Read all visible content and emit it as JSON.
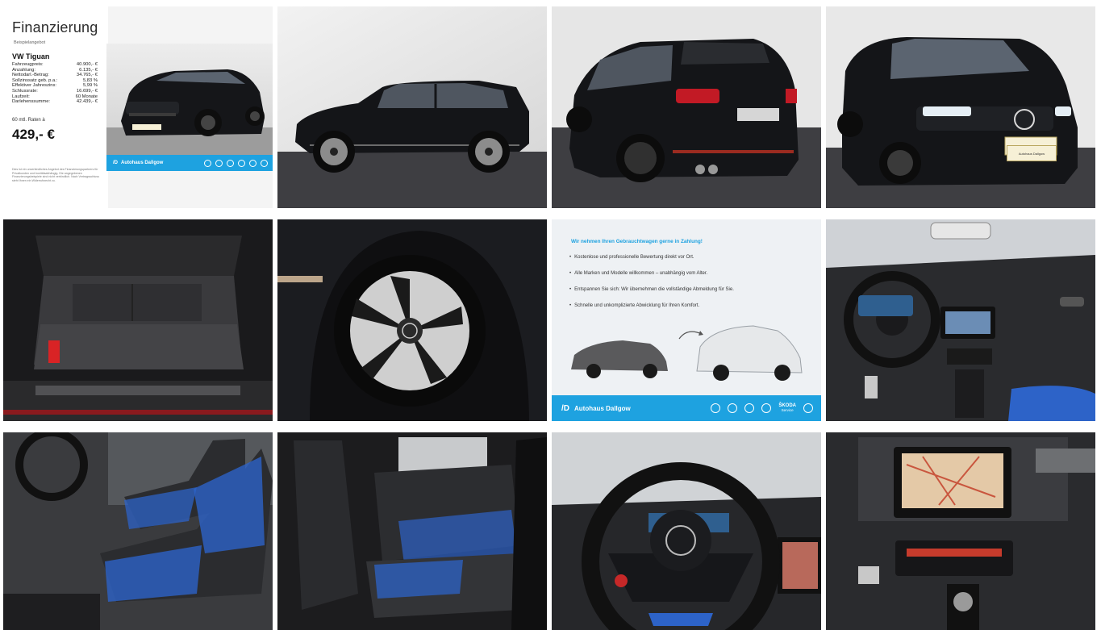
{
  "gallery": {
    "financing_card": {
      "title": "Finanzierung",
      "subtitle": "Beispielangebot",
      "model": "VW Tiguan",
      "rows": [
        {
          "label": "Fahrzeugpreis:",
          "value": "40.900,- €"
        },
        {
          "label": "Anzahlung:",
          "value": "6.135,- €"
        },
        {
          "label": "Nettodarl.-Betrag:",
          "value": "34.765,- €"
        },
        {
          "label": "Sollzinssatz geb. p.a.:",
          "value": "5,83 %"
        },
        {
          "label": "Effektiver Jahreszins:",
          "value": "5,99 %"
        },
        {
          "label": "Schlussrate:",
          "value": "16.699,- €"
        },
        {
          "label": "Laufzeit:",
          "value": "60 Monate"
        },
        {
          "label": "Darlehenssumme:",
          "value": "42.439,- €"
        }
      ],
      "rates_label": "60 mtl. Raten à",
      "monthly_rate": "429,- €",
      "fine_print": "Dies ist ein unverbindliches Angebot des Finanzierungspartners für Privatkunden und bonitätsabhängig. Die angegebenen Finanzierungsbeispiele sind nicht verbindlich. Nach Vertragsschluss steht Ihnen ein Widerrufsrecht zu.",
      "dealer_name": "Autohaus Dallgow"
    },
    "trade_in_card": {
      "headline": "Wir nehmen Ihren Gebrauchtwagen gerne in Zahlung!",
      "bullets": [
        "Kostenlose und professionelle Bewertung direkt vor Ort.",
        "Alle Marken und Modelle willkommen – unabhängig vom Alter.",
        "Entspannen Sie sich: Wir übernehmen die vollständige Abmeldung für Sie.",
        "Schnelle und unkomplizierte Abwicklung für Ihren Komfort."
      ],
      "dealer_name": "Autohaus Dallgow",
      "skoda_label": "ŠKODA",
      "skoda_sub": "Service"
    },
    "dealer_plate": "Autohaus Dallgow",
    "colors": {
      "brand_blue": "#1ea2e0",
      "car_black": "#141518",
      "studio_grey": "#3e3e42",
      "seat_blue": "#2d63c8"
    }
  }
}
